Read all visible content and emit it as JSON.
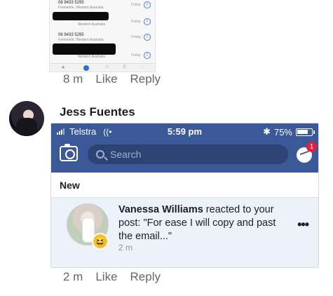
{
  "top_comment": {
    "calllog": {
      "rows": [
        {
          "number": "08 9433 5295",
          "location": "Fremantle, Western Australia",
          "day": "Friday"
        },
        {
          "number": "",
          "location": "Western Australia",
          "day": "Friday"
        },
        {
          "number": "08 9433 5295",
          "location": "Fremantle, Western Australia",
          "day": "Friday"
        },
        {
          "number": "",
          "location": "Western Australia",
          "day": "Friday"
        }
      ]
    },
    "time": "8 m",
    "like_label": "Like",
    "reply_label": "Reply"
  },
  "comment": {
    "author": "Jess Fuentes",
    "time": "2 m",
    "like_label": "Like",
    "reply_label": "Reply"
  },
  "phone": {
    "carrier": "Telstra",
    "time": "5:59 pm",
    "battery": "75%",
    "search_placeholder": "Search",
    "messenger_badge": "1",
    "section_label": "New",
    "notification": {
      "actor": "Vanessa Williams",
      "text": " reacted to your post: \"For ease I will copy and past the email...\"",
      "time": "2 m",
      "more_label": "•••"
    }
  },
  "colors": {
    "facebook_blue": "#3b5998",
    "notification_bg": "#edf2fa",
    "badge_red": "#e41e3f"
  }
}
